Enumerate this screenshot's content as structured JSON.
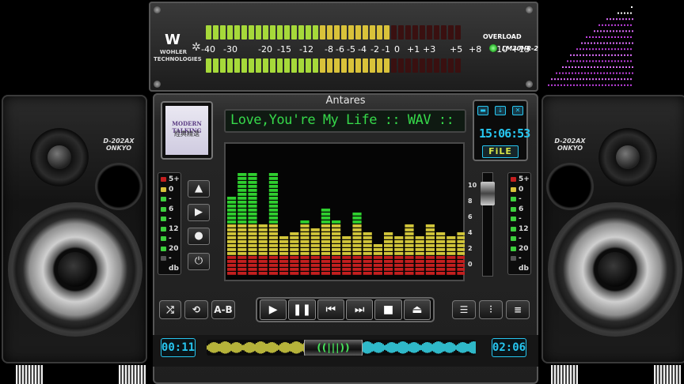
{
  "app": {
    "title": "Antares"
  },
  "vu_meter": {
    "brand_line1": "WOHLER",
    "brand_line2": "TECHNOLOGIES",
    "overload_label": "OVERLOAD",
    "model": "LM30HR-2",
    "scale": [
      "-40",
      "-30",
      "-20",
      "-15",
      "-12",
      "-8",
      "-6",
      "-5",
      "-4",
      "-2",
      "-1",
      "0",
      "+1",
      "+3",
      "+5",
      "+8",
      "+10",
      "+13"
    ],
    "level_top": 0.62,
    "level_bottom": 0.62
  },
  "track": {
    "scroll_text": "Love,You're My Life :: WAV ::"
  },
  "album": {
    "line1": "MODERN TALKING",
    "line2": "經典精選"
  },
  "clock": {
    "time": "15:06:53",
    "file_button": "FiLE"
  },
  "side_meter": {
    "labels": [
      "5+",
      "0",
      "-",
      "6",
      "-",
      "12",
      "-",
      "20",
      "-",
      "db"
    ]
  },
  "slider_scale": [
    "10",
    "8",
    "6",
    "4",
    "2",
    "0"
  ],
  "buttons": {
    "ab_label": "A-B"
  },
  "position": {
    "elapsed": "00:11",
    "total": "02:06",
    "progress": 0.55
  },
  "spectrum": {
    "levels": [
      0.5,
      0.72,
      0.72,
      0.28,
      0.72,
      0.18,
      0.22,
      0.32,
      0.24,
      0.42,
      0.32,
      0.18,
      0.38,
      0.2,
      0.1,
      0.22,
      0.16,
      0.26,
      0.18,
      0.26,
      0.2,
      0.16,
      0.22
    ]
  },
  "speakers": {
    "brand1": "D-202AX",
    "brand2": "ONKYO"
  },
  "colors": {
    "lcd_green": "#36d94a",
    "lcd_cyan": "#27c6f0",
    "meter_yellow": "#d2c63a",
    "meter_red": "#c41f1f"
  }
}
